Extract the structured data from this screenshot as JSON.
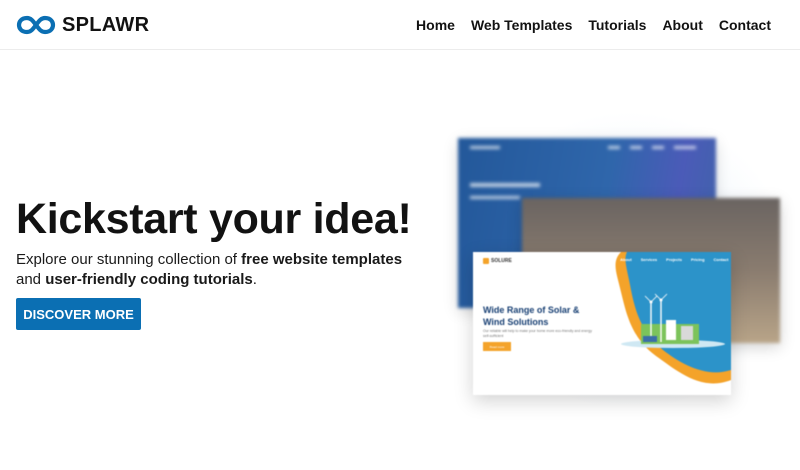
{
  "brand": {
    "name": "SPLAWR",
    "logo_icon": "infinity-link-icon",
    "accent_color": "#0b6fb3"
  },
  "nav": {
    "items": [
      {
        "label": "Home"
      },
      {
        "label": "Web Templates"
      },
      {
        "label": "Tutorials"
      },
      {
        "label": "About"
      },
      {
        "label": "Contact"
      }
    ]
  },
  "hero": {
    "title": "Kickstart your idea!",
    "description_prefix": "Explore our stunning collection of ",
    "description_bold_1": "free website templates",
    "description_mid": " and ",
    "description_bold_2": "user-friendly coding tutorials",
    "description_suffix": ".",
    "cta_label": "DISCOVER MORE",
    "cta_color": "#0b6fb3"
  },
  "showcase": {
    "front_card": {
      "brand": "SOLURE",
      "nav": [
        "Home",
        "About",
        "Services",
        "Projects",
        "Pricing",
        "Contact"
      ],
      "heading": "Wide Range of Solar & Wind Solutions",
      "subtext": "Our reliable will help to make your home more eco-friendly and energy self-sufficient",
      "button": "Read more"
    }
  }
}
